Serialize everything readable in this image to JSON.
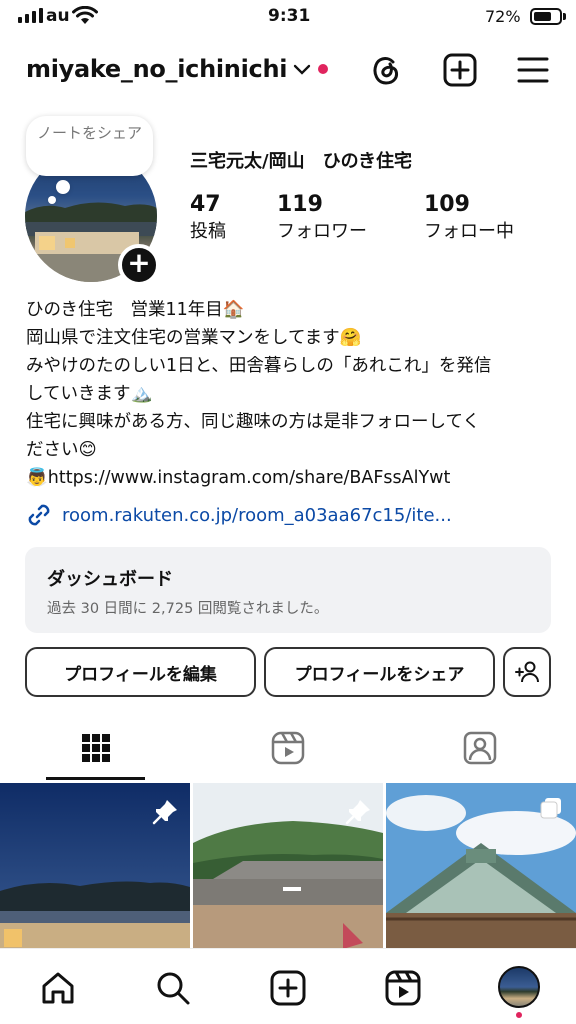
{
  "status_bar": {
    "carrier": "au",
    "time": "9:31",
    "battery": "72%"
  },
  "header": {
    "username": "miyake_no_ichinichi"
  },
  "profile": {
    "note": "ノートをシェア",
    "full_name": "三宅元太/岡山　ひのき住宅",
    "stats": [
      {
        "count": "47",
        "label": "投稿"
      },
      {
        "count": "119",
        "label": "フォロワー"
      },
      {
        "count": "109",
        "label": "フォロー中"
      }
    ],
    "bio_lines": [
      "ひのき住宅　営業11年目🏠",
      "岡山県で注文住宅の営業マンをしてます🤗",
      "みやけのたのしい1日と、田舎暮らしの「あれこれ」を発信",
      "していきます🏔️",
      "住宅に興味がある方、同じ趣味の方は是非フォローしてく",
      "ださい😊",
      "👼https://www.instagram.com/share/BAFssAlYwt"
    ],
    "link": "room.rakuten.co.jp/room_a03aa67c15/ite..."
  },
  "dashboard": {
    "title": "ダッシュボード",
    "subtitle": "過去 30 日間に 2,725 回閲覧されました。"
  },
  "buttons": {
    "edit": "プロフィールを編集",
    "share": "プロフィールをシェア"
  },
  "tabs": [
    "grid-icon",
    "reels-icon",
    "tagged-icon"
  ],
  "nav": [
    "home-icon",
    "search-icon",
    "create-icon",
    "reels-icon",
    "profile-avatar"
  ],
  "colors": {
    "link": "#0c4aa6",
    "notification_dot": "#e0245e"
  }
}
